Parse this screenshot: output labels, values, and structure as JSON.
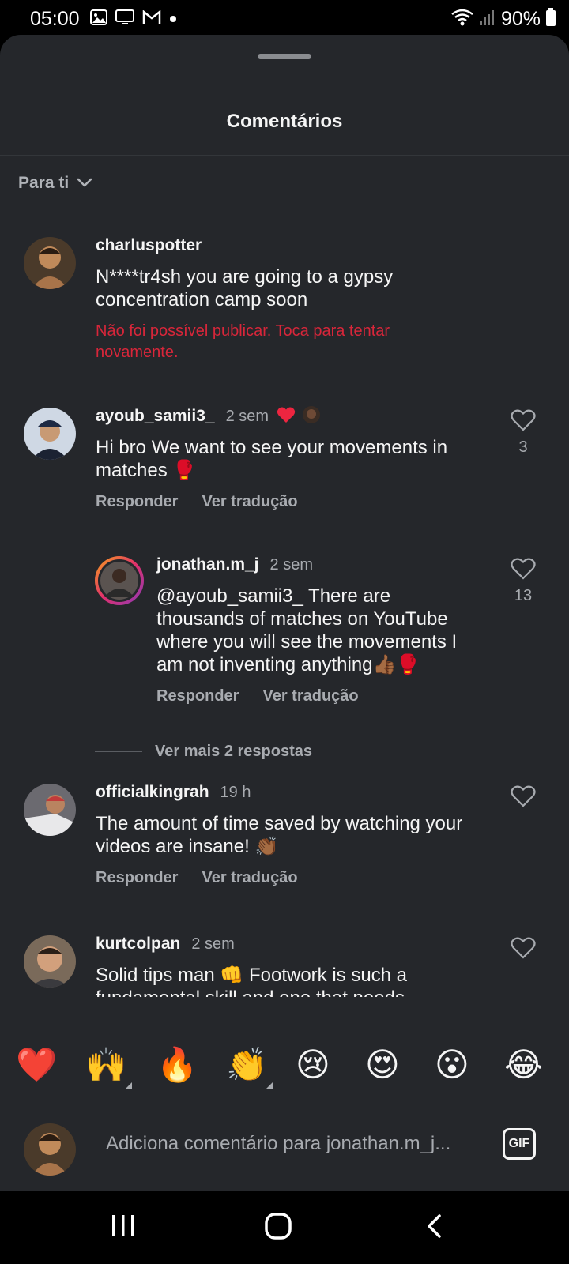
{
  "status_bar": {
    "time": "05:00",
    "battery": "90%",
    "icons": [
      "gallery-icon",
      "cast-icon",
      "gmail-icon",
      "dot-icon",
      "wifi-icon",
      "signal-icon",
      "battery-icon"
    ]
  },
  "sheet": {
    "title": "Comentários",
    "sort_label": "Para ti"
  },
  "comments": [
    {
      "username": "charluspotter",
      "text": "N****tr4sh you are going to a gypsy concentration camp soon",
      "error": "Não foi possível publicar. Toca para tentar novamente."
    },
    {
      "username": "ayoub_samii3_",
      "time": "2 sem",
      "text": "Hi bro We want to see your movements in matches 🥊",
      "likes": "3",
      "reply": "Responder",
      "translate": "Ver tradução"
    },
    {
      "username": "jonathan.m_j",
      "time": "2 sem",
      "text": "@ayoub_samii3_ There are thousands of matches on YouTube where you will see the movements I am not inventing anything👍🏾🥊",
      "likes": "13",
      "reply": "Responder",
      "translate": "Ver tradução"
    },
    {
      "username": "officialkingrah",
      "time": "19 h",
      "text": "The amount of time saved by watching your videos are insane! 👏🏾",
      "reply": "Responder",
      "translate": "Ver tradução"
    },
    {
      "username": "kurtcolpan",
      "time": "2 sem",
      "text": "Solid tips man 👊 Footwork is such a fundamental skill and one that needs constant work. I like the tips most about"
    }
  ],
  "more_replies": "Ver mais 2 respostas",
  "emoji_bar": [
    "❤️",
    "🙌",
    "🔥",
    "👏",
    "😢",
    "😍",
    "😮",
    "😂"
  ],
  "composer": {
    "placeholder": "Adiciona comentário para jonathan.m_j...",
    "gif_label": "GIF"
  },
  "colors": {
    "sheet_bg": "#25272b",
    "error_red": "#d8263a",
    "heart_red": "#ed2540",
    "muted_text": "#a8abb0"
  }
}
